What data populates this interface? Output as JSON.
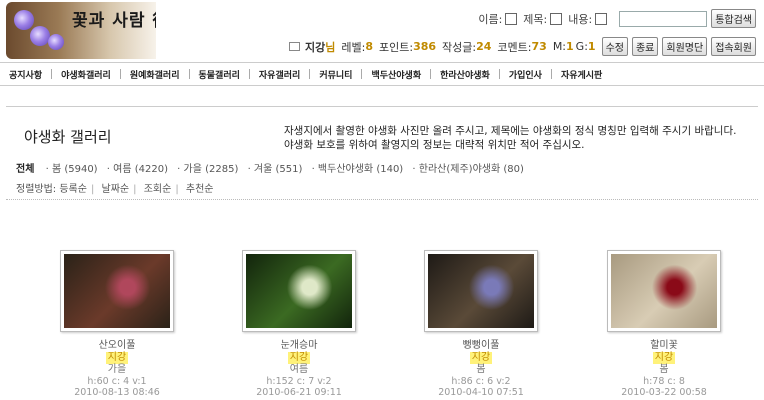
{
  "logo": {
    "text": "꽃과 사람 後기"
  },
  "search": {
    "name_label": "이름:",
    "subject_label": "제목:",
    "content_label": "내용:",
    "input_value": "",
    "submit_label": "통합검색"
  },
  "user": {
    "name": "지강",
    "name_suffix": "님",
    "level_label": "레벨:",
    "level": "8",
    "points_label": "포인트:",
    "points": "386",
    "posts_label": "작성글:",
    "posts": "24",
    "comments_label": "코멘트:",
    "comments": "73",
    "m_label": "M:",
    "m": "1",
    "g_label": "G:",
    "g": "1",
    "buttons": [
      "수정",
      "종료",
      "회원명단",
      "접속회원"
    ]
  },
  "nav": [
    "공지사항",
    "야생화갤러리",
    "원예화갤러리",
    "동물갤러리",
    "자유갤러리",
    "커뮤니티",
    "백두산야생화",
    "한라산야생화",
    "가입인사",
    "자유게시판"
  ],
  "gallery": {
    "title": "야생화 갤러리",
    "description_1": "자생지에서 촬영한 야생화 사진만 올려 주시고, 제목에는 야생화의 정식 명칭만 입력해 주시기 바랍니다.",
    "description_2": "야생화 보호를 위하여 촬영지의 정보는 대략적 위치만 적어 주십시오."
  },
  "categories": {
    "all": "전체",
    "items": [
      "· 봄 (5940)",
      "· 여름 (4220)",
      "· 가을 (2285)",
      "· 겨울 (551)",
      "· 백두산야생화 (140)",
      "· 한라산(제주)야생화 (80)"
    ]
  },
  "sort": {
    "label": "정렬방법:",
    "items": [
      "등록순",
      "날짜순",
      "조회순",
      "추천순"
    ]
  },
  "thumbs": [
    {
      "title": "산오이풀",
      "author": "지강",
      "season": "가을",
      "stats": "h:60 c: 4 v:1",
      "date": "2010-08-13 08:46",
      "palette": [
        "#2a2218",
        "#6b3a2a",
        "#b0475c"
      ]
    },
    {
      "title": "눈개승마",
      "author": "지강",
      "season": "여름",
      "stats": "h:152 c: 7 v:2",
      "date": "2010-06-21 09:11",
      "palette": [
        "#12240c",
        "#3b6a22",
        "#dfe8c8"
      ]
    },
    {
      "title": "뻥뻥이풀",
      "author": "지강",
      "season": "봄",
      "stats": "h:86 c: 6 v:2",
      "date": "2010-04-10 07:51",
      "palette": [
        "#1e1a16",
        "#5a4a38",
        "#7a7ab8"
      ]
    },
    {
      "title": "할미꽃",
      "author": "지강",
      "season": "봄",
      "stats": "h:78 c: 8",
      "date": "2010-03-22 00:58",
      "palette": [
        "#a89a80",
        "#d8ccb4",
        "#8a0a18"
      ]
    }
  ]
}
